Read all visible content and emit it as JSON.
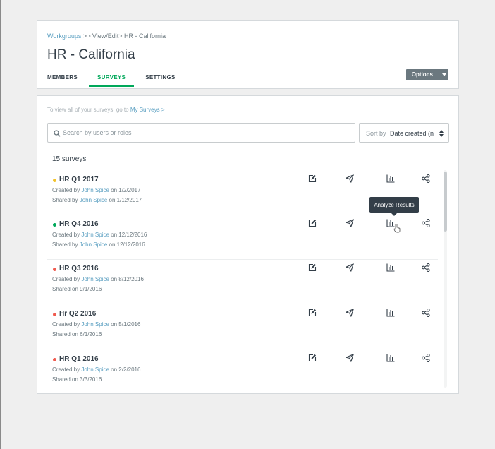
{
  "breadcrumb": {
    "link": "Workgroups",
    "rest": " > <View/Edit> HR - California"
  },
  "page_title": "HR - California",
  "tabs": [
    {
      "label": "MEMBERS",
      "active": false
    },
    {
      "label": "SURVEYS",
      "active": true
    },
    {
      "label": "SETTINGS",
      "active": false
    }
  ],
  "options": {
    "label": "Options"
  },
  "hint": {
    "text": "To view all of your surveys, go to ",
    "link": "My Surveys >"
  },
  "search": {
    "placeholder": "Search by users or roles",
    "value": ""
  },
  "sort": {
    "label": "Sort by",
    "value": "Date created (n"
  },
  "count": "15 surveys",
  "tooltip": "Analyze Results",
  "colors": {
    "accent": "#00a85a",
    "link": "#5a9fc1",
    "dot_yellow": "#f2c22b",
    "dot_green": "#00a85a",
    "dot_red": "#f05b4f"
  },
  "icons": [
    "edit-icon",
    "send-icon",
    "analyze-icon",
    "share-icon"
  ],
  "surveys": [
    {
      "title": "HR Q1 2017",
      "status_color": "#f2c22b",
      "created_prefix": "Created by ",
      "created_by": "John Spice",
      "created_suffix": " on 1/2/2017",
      "shared_prefix": "Shared by ",
      "shared_by": "John Spice",
      "shared_suffix": " on 1/12/2017"
    },
    {
      "title": "HR Q4 2016",
      "status_color": "#00a85a",
      "created_prefix": "Created by ",
      "created_by": "John Spice",
      "created_suffix": " on 12/12/2016",
      "shared_prefix": "Shared by ",
      "shared_by": "John Spice",
      "shared_suffix": " on 12/12/2016"
    },
    {
      "title": "HR Q3 2016",
      "status_color": "#f05b4f",
      "created_prefix": "Created by ",
      "created_by": "John Spice",
      "created_suffix": " on 8/12/2016",
      "shared_prefix": "Shared on 9/1/2016",
      "shared_by": "",
      "shared_suffix": ""
    },
    {
      "title": "Hr Q2 2016",
      "status_color": "#f05b4f",
      "created_prefix": "Created by ",
      "created_by": "John Spice",
      "created_suffix": " on 5/1/2016",
      "shared_prefix": "Shared on 6/1/2016",
      "shared_by": "",
      "shared_suffix": ""
    },
    {
      "title": "HR Q1 2016",
      "status_color": "#f05b4f",
      "created_prefix": "Created by ",
      "created_by": "John Spice",
      "created_suffix": " on 2/2/2016",
      "shared_prefix": "Shared on 3/3/2016",
      "shared_by": "",
      "shared_suffix": ""
    }
  ]
}
